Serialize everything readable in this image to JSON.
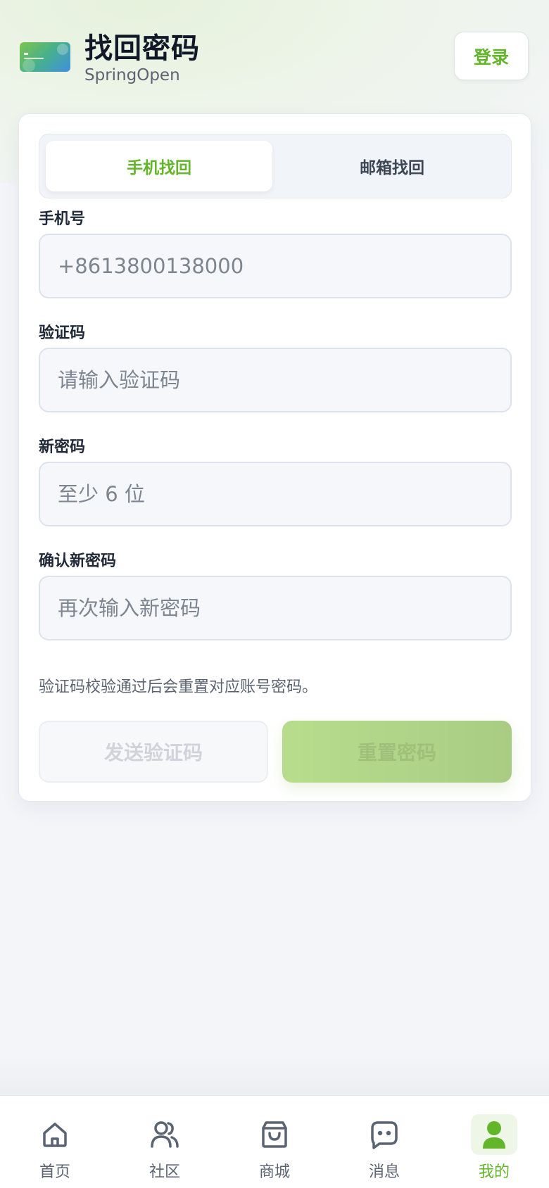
{
  "header": {
    "title": "找回密码",
    "subtitle": "SpringOpen",
    "login_label": "登录"
  },
  "tabs": [
    {
      "label": "手机找回",
      "active": true
    },
    {
      "label": "邮箱找回",
      "active": false
    }
  ],
  "form": {
    "phone": {
      "label": "手机号",
      "value": "",
      "placeholder": "+8613800138000"
    },
    "code": {
      "label": "验证码",
      "value": "",
      "placeholder": "请输入验证码"
    },
    "new_password": {
      "label": "新密码",
      "value": "",
      "placeholder": "至少 6 位"
    },
    "confirm_password": {
      "label": "确认新密码",
      "value": "",
      "placeholder": "再次输入新密码"
    },
    "hint": "验证码校验通过后会重置对应账号密码。",
    "send_code_label": "发送验证码",
    "reset_label": "重置密码"
  },
  "tabbar": [
    {
      "label": "首页",
      "icon": "home-icon",
      "active": false
    },
    {
      "label": "社区",
      "icon": "users-icon",
      "active": false
    },
    {
      "label": "商城",
      "icon": "shopping-bag-icon",
      "active": false
    },
    {
      "label": "消息",
      "icon": "message-icon",
      "active": false
    },
    {
      "label": "我的",
      "icon": "user-icon",
      "active": true
    }
  ],
  "colors": {
    "accent": "#63b52a",
    "background": "#f3f5f9",
    "card": "#ffffff"
  }
}
